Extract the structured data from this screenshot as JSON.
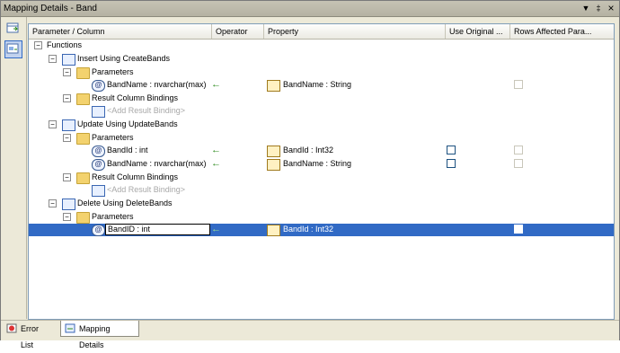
{
  "window": {
    "title": "Mapping Details - Band",
    "dropdown_glyph": "▼",
    "pin_glyph": "‡",
    "close_glyph": "×"
  },
  "columns": [
    "Parameter / Column",
    "Operator",
    "Property",
    "Use Original ...",
    "Rows Affected Para..."
  ],
  "tree": {
    "root": "Functions",
    "insert": {
      "label": "Insert Using CreateBands",
      "params_label": "Parameters",
      "param1": "BandName : nvarchar(max)",
      "prop1": "BandName : String",
      "results_label": "Result Column Bindings",
      "add_binding": "<Add Result Binding>"
    },
    "update": {
      "label": "Update Using UpdateBands",
      "params_label": "Parameters",
      "param1": "BandId : int",
      "prop1": "BandId : Int32",
      "param2": "BandName : nvarchar(max)",
      "prop2": "BandName : String",
      "results_label": "Result Column Bindings",
      "add_binding": "<Add Result Binding>"
    },
    "delete": {
      "label": "Delete Using DeleteBands",
      "params_label": "Parameters",
      "param1": "BandID : int",
      "prop1": "BandId : Int32"
    }
  },
  "glyphs": {
    "minus": "−",
    "arrow": "←",
    "at": "@"
  },
  "tabs": [
    {
      "label": "Error List"
    },
    {
      "label": "Mapping Details"
    }
  ],
  "colors": {
    "selection": "#316ac5",
    "arrow": "#2b8a1c"
  }
}
